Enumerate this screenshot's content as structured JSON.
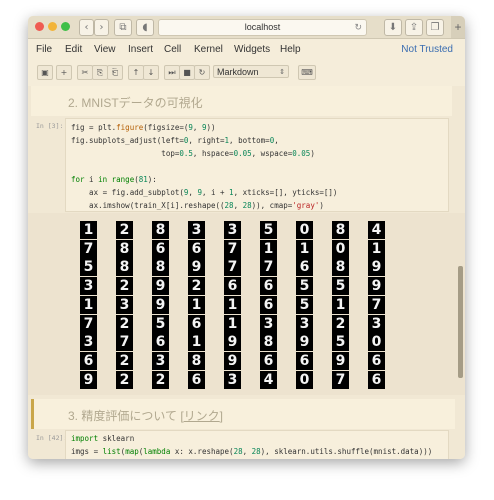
{
  "browser": {
    "url": "localhost",
    "nav_back": "‹",
    "nav_forward": "›",
    "sidebar_icon": "⧉",
    "shield_icon": "◖",
    "reload_icon": "↻",
    "download_icon": "⬇",
    "share_icon": "⇪",
    "tabs_icon": "❐",
    "plus": "+"
  },
  "menu": {
    "items": [
      "File",
      "Edit",
      "View",
      "Insert",
      "Cell",
      "Kernel",
      "Widgets",
      "Help"
    ],
    "not_trusted": "Not Trusted"
  },
  "toolbar": {
    "save_icon": "▣",
    "add_icon": "+",
    "cut_icon": "✂",
    "copy_icon": "⎘",
    "paste_icon": "⎗",
    "up_icon": "↑",
    "down_icon": "↓",
    "skip_icon": "⏭",
    "stop_icon": "■",
    "restart_icon": "↻",
    "cell_type": "Markdown",
    "cell_type_arrow": "⇕",
    "keyboard_icon": "⌨"
  },
  "cells": {
    "md1": {
      "text": "2. MNISTデータの可視化"
    },
    "code1": {
      "prompt": "In [3]:",
      "lines": [
        "fig = plt.figure(figsize=(9, 9))",
        "fig.subplots_adjust(left=0, right=1, bottom=0,",
        "                    top=0.5, hspace=0.05, wspace=0.05)",
        "",
        "for i in range(81):",
        "    ax = fig.add_subplot(9, 9, i + 1, xticks=[], yticks=[])",
        "    ax.imshow(train_X[i].reshape((28, 28)), cmap='gray')"
      ]
    },
    "output_digits": [
      [
        "1",
        "7",
        "5",
        "3",
        "1",
        "7",
        "3",
        "6",
        "9"
      ],
      [
        "2",
        "8",
        "8",
        "2",
        "3",
        "2",
        "7",
        "2",
        "2"
      ],
      [
        "8",
        "6",
        "8",
        "9",
        "9",
        "5",
        "6",
        "3",
        "2"
      ],
      [
        "3",
        "6",
        "9",
        "2",
        "1",
        "6",
        "1",
        "8",
        "6"
      ],
      [
        "3",
        "7",
        "7",
        "6",
        "1",
        "1",
        "9",
        "9",
        "3"
      ],
      [
        "5",
        "1",
        "7",
        "6",
        "6",
        "3",
        "8",
        "6",
        "4"
      ],
      [
        "0",
        "1",
        "6",
        "5",
        "5",
        "3",
        "9",
        "6",
        "0"
      ],
      [
        "8",
        "0",
        "8",
        "5",
        "1",
        "2",
        "5",
        "9",
        "7"
      ],
      [
        "4",
        "1",
        "9",
        "9",
        "7",
        "3",
        "0",
        "6",
        "6"
      ]
    ],
    "md2": {
      "text_before": "3. 精度評価について [",
      "link": "リンク",
      "text_after": "]"
    },
    "code2": {
      "prompt": "In [42]:",
      "lines": [
        "import sklearn",
        "imgs = list(map(lambda x: x.reshape(28, 28), sklearn.utils.shuffle(mnist.data)))"
      ]
    }
  }
}
